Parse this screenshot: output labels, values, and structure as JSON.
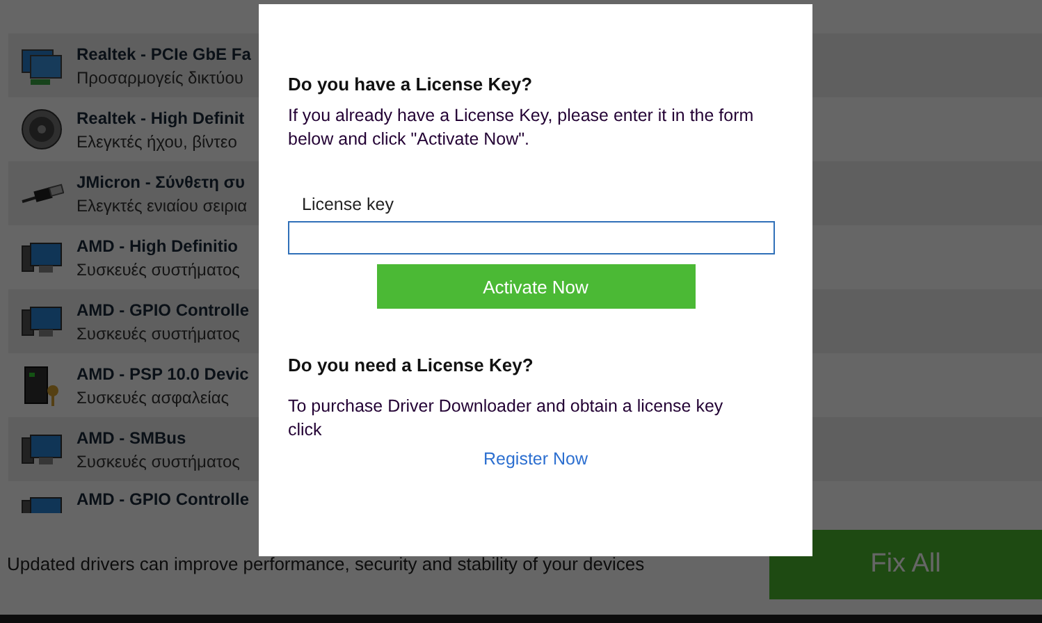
{
  "devices": [
    {
      "name": "Realtek - PCIe GbE Fa",
      "category": "Προσαρμογείς δικτύου",
      "kind": "network"
    },
    {
      "name": "Realtek - High Definit",
      "category": "Ελεγκτές ήχου, βίντεο",
      "kind": "speaker"
    },
    {
      "name": "JMicron - Σύνθετη συ",
      "category": "Ελεγκτές ενιαίου σειρια",
      "kind": "usb"
    },
    {
      "name": "AMD - High Definitio",
      "category": "Συσκευές συστήματος",
      "kind": "computer"
    },
    {
      "name": "AMD - GPIO Controlle",
      "category": "Συσκευές συστήματος",
      "kind": "computer"
    },
    {
      "name": "AMD - PSP 10.0 Devic",
      "category": "Συσκευές ασφαλείας",
      "kind": "security"
    },
    {
      "name": "AMD - SMBus",
      "category": "Συσκευές συστήματος",
      "kind": "computer"
    },
    {
      "name": "AMD - GPIO Controlle",
      "kind": "computer"
    }
  ],
  "footer": {
    "message": "Updated drivers can improve performance, security and stability of your devices",
    "button": "Fix All"
  },
  "dialog": {
    "heading_1": "Do you have a License Key?",
    "text_1": "If you already have a License Key, please enter it in the form below and click \"Activate Now\".",
    "field_label": "License key",
    "activate_button": "Activate Now",
    "heading_2": "Do you need a License Key?",
    "text_2": "To purchase Driver Downloader and obtain a license key click",
    "link": "Register Now"
  }
}
